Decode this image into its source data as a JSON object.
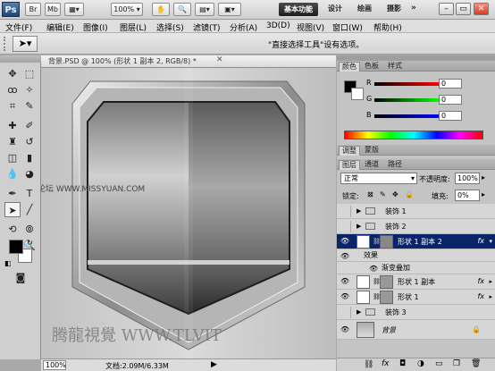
{
  "appbar": {
    "logo": "Ps",
    "buttons": [
      "Br",
      "Mb"
    ],
    "zoom": "100%",
    "workspaces": {
      "basic": "基本功能",
      "design": "设计",
      "painting": "绘画",
      "photo": "摄影"
    },
    "more": "»"
  },
  "menubar": [
    "文件(F)",
    "编辑(E)",
    "图像(I)",
    "图层(L)",
    "选择(S)",
    "滤镜(T)",
    "分析(A)",
    "3D(D)",
    "视图(V)",
    "窗口(W)",
    "帮助(H)"
  ],
  "options": {
    "hint": "\"直接选择工具\"设有选项。"
  },
  "document": {
    "tab_title": "背景.PSD @ 100% (形状 1 副本 2, RGB/8) *",
    "watermark_top": "思缘设计论坛   WWW.MISSYUAN.COM",
    "watermark_bottom": "腾龍視覺 WWW.TLVIT"
  },
  "status": {
    "zoom": "100%",
    "doc": "文档:2.09M/6.33M"
  },
  "colors": {
    "foreground": "#000000",
    "background": "#ffffff",
    "accent": "#0a246a"
  },
  "color_panel": {
    "tabs": [
      "颜色",
      "色板",
      "样式"
    ],
    "channels": [
      {
        "label": "R",
        "value": "0"
      },
      {
        "label": "G",
        "value": "0"
      },
      {
        "label": "B",
        "value": "0"
      }
    ]
  },
  "adjust_tabs": [
    "调整",
    "蒙版"
  ],
  "layers_panel": {
    "tabs": [
      "图层",
      "通道",
      "路径"
    ],
    "blend_mode": "正常",
    "opacity_label": "不透明度:",
    "opacity_value": "100%",
    "lock_label": "锁定:",
    "fill_label": "填充:",
    "fill_value": "0%",
    "rows": [
      {
        "name": "装饰 1",
        "type": "group",
        "visible": false
      },
      {
        "name": "装饰 2",
        "type": "group",
        "visible": false
      },
      {
        "name": "形状 1 副本 2",
        "type": "shape",
        "visible": true,
        "selected": true,
        "fx": "fx"
      },
      {
        "name": "效果",
        "type": "effects",
        "visible": true
      },
      {
        "name": "渐变叠加",
        "type": "effect",
        "visible": true
      },
      {
        "name": "形状 1 副本",
        "type": "shape",
        "visible": true,
        "fx": "fx"
      },
      {
        "name": "形状 1",
        "type": "shape",
        "visible": true,
        "fx": "fx"
      },
      {
        "name": "装饰 3",
        "type": "group",
        "visible": false
      },
      {
        "name": "背景",
        "type": "background",
        "visible": true
      }
    ]
  }
}
